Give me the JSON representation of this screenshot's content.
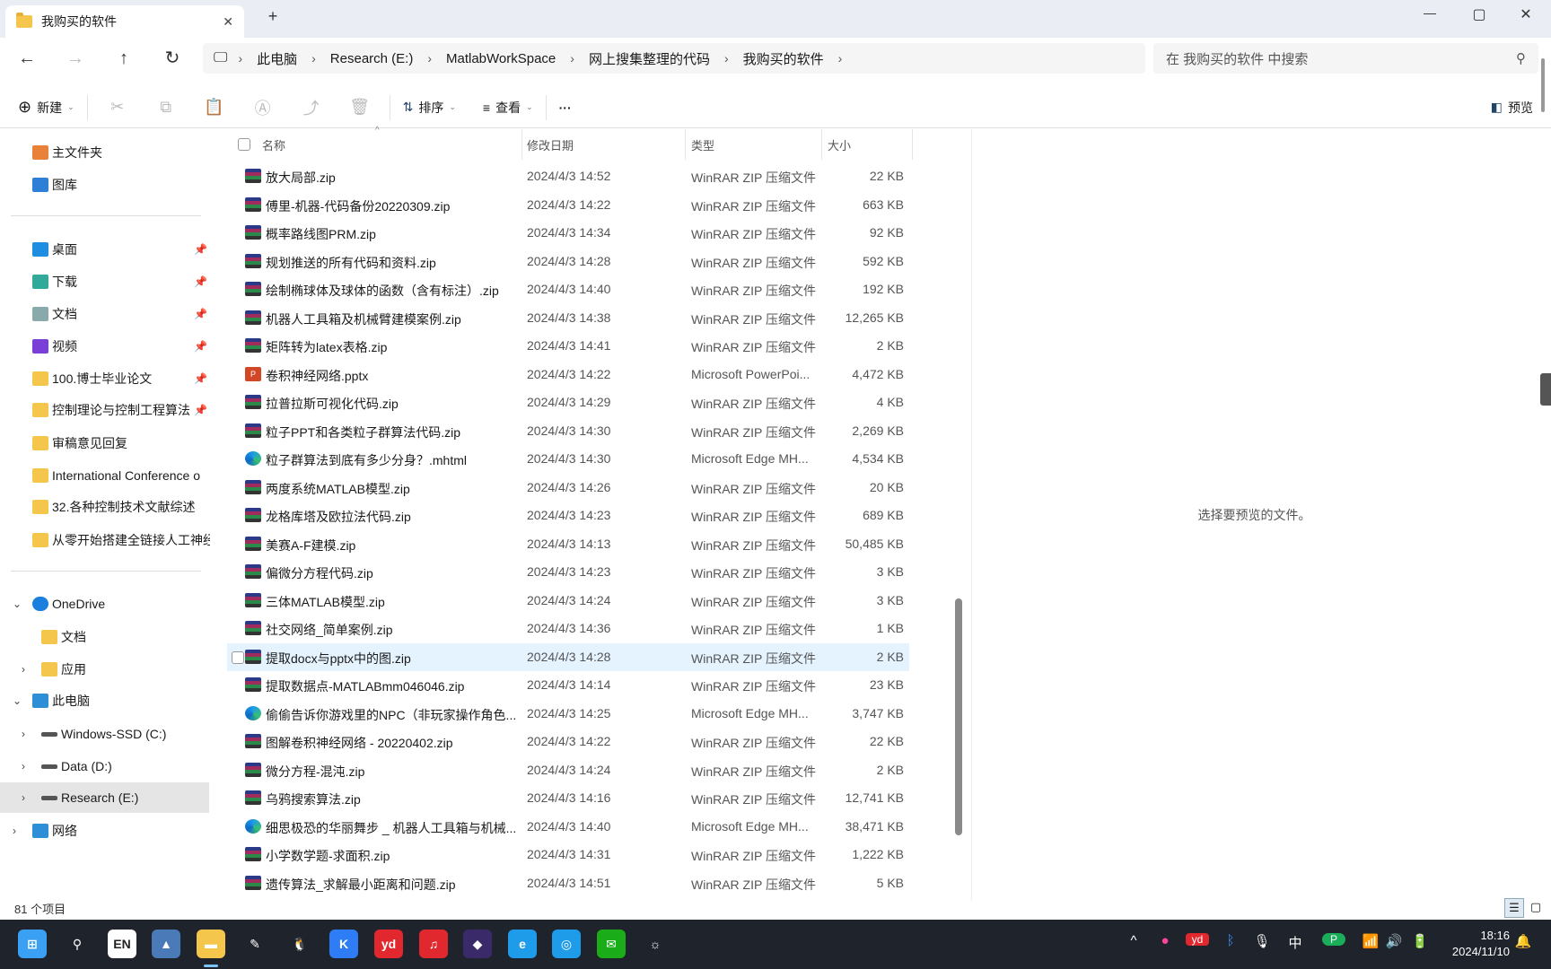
{
  "window": {
    "tab_title": "我购买的软件",
    "new_tab": "+",
    "minimize": "—",
    "maximize": "▢",
    "close": "✕"
  },
  "address": {
    "crumbs": [
      "此电脑",
      "Research (E:)",
      "MatlabWorkSpace",
      "网上搜集整理的代码",
      "我购买的软件"
    ],
    "search_placeholder": "在 我购买的软件 中搜索"
  },
  "toolbar": {
    "new": "新建",
    "sort": "排序",
    "view": "查看",
    "more": "···",
    "preview": "预览"
  },
  "sidebar": {
    "items": [
      {
        "label": "主文件夹",
        "icon": "home"
      },
      {
        "label": "图库",
        "icon": "gallery"
      },
      {
        "label": "桌面",
        "icon": "desktop",
        "pin": true
      },
      {
        "label": "下载",
        "icon": "download",
        "pin": true
      },
      {
        "label": "文档",
        "icon": "document",
        "pin": true
      },
      {
        "label": "视频",
        "icon": "video",
        "pin": true
      },
      {
        "label": "100.博士毕业论文",
        "icon": "folder",
        "pin": true
      },
      {
        "label": "控制理论与控制工程算法",
        "icon": "folder",
        "pin": true
      },
      {
        "label": "审稿意见回复",
        "icon": "folder"
      },
      {
        "label": "International Conference o",
        "icon": "folder"
      },
      {
        "label": "32.各种控制技术文献综述",
        "icon": "folder"
      },
      {
        "label": "从零开始搭建全链接人工神经",
        "icon": "folder"
      },
      {
        "label": "OneDrive",
        "icon": "cloud",
        "chevron": "⌄"
      },
      {
        "label": "文档",
        "icon": "folder"
      },
      {
        "label": "应用",
        "icon": "folder",
        "chevron": "›"
      },
      {
        "label": "此电脑",
        "icon": "pc",
        "chevron": "⌄"
      },
      {
        "label": "Windows-SSD (C:)",
        "icon": "drive",
        "chevron": "›"
      },
      {
        "label": "Data (D:)",
        "icon": "drive",
        "chevron": "›"
      },
      {
        "label": "Research (E:)",
        "icon": "drive",
        "chevron": "›",
        "selected": true
      },
      {
        "label": "网络",
        "icon": "network",
        "chevron": "›"
      }
    ]
  },
  "columns": {
    "name": "名称",
    "date": "修改日期",
    "type": "类型",
    "size": "大小"
  },
  "files": [
    {
      "name": "放大局部.zip",
      "date": "2024/4/3 14:52",
      "type": "WinRAR ZIP 压缩文件",
      "size": "22 KB",
      "icon": "zip"
    },
    {
      "name": "傅里-机器-代码备份20220309.zip",
      "date": "2024/4/3 14:22",
      "type": "WinRAR ZIP 压缩文件",
      "size": "663 KB",
      "icon": "zip"
    },
    {
      "name": "概率路线图PRM.zip",
      "date": "2024/4/3 14:34",
      "type": "WinRAR ZIP 压缩文件",
      "size": "92 KB",
      "icon": "zip"
    },
    {
      "name": "规划推送的所有代码和资料.zip",
      "date": "2024/4/3 14:28",
      "type": "WinRAR ZIP 压缩文件",
      "size": "592 KB",
      "icon": "zip"
    },
    {
      "name": "绘制椭球体及球体的函数（含有标注）.zip",
      "date": "2024/4/3 14:40",
      "type": "WinRAR ZIP 压缩文件",
      "size": "192 KB",
      "icon": "zip"
    },
    {
      "name": "机器人工具箱及机械臂建模案例.zip",
      "date": "2024/4/3 14:38",
      "type": "WinRAR ZIP 压缩文件",
      "size": "12,265 KB",
      "icon": "zip"
    },
    {
      "name": "矩阵转为latex表格.zip",
      "date": "2024/4/3 14:41",
      "type": "WinRAR ZIP 压缩文件",
      "size": "2 KB",
      "icon": "zip"
    },
    {
      "name": "卷积神经网络.pptx",
      "date": "2024/4/3 14:22",
      "type": "Microsoft PowerPoi...",
      "size": "4,472 KB",
      "icon": "pptx"
    },
    {
      "name": "拉普拉斯可视化代码.zip",
      "date": "2024/4/3 14:29",
      "type": "WinRAR ZIP 压缩文件",
      "size": "4 KB",
      "icon": "zip"
    },
    {
      "name": "粒子PPT和各类粒子群算法代码.zip",
      "date": "2024/4/3 14:30",
      "type": "WinRAR ZIP 压缩文件",
      "size": "2,269 KB",
      "icon": "zip"
    },
    {
      "name": "粒子群算法到底有多少分身？.mhtml",
      "date": "2024/4/3 14:30",
      "type": "Microsoft Edge MH...",
      "size": "4,534 KB",
      "icon": "edge"
    },
    {
      "name": "两度系统MATLAB模型.zip",
      "date": "2024/4/3 14:26",
      "type": "WinRAR ZIP 压缩文件",
      "size": "20 KB",
      "icon": "zip"
    },
    {
      "name": "龙格库塔及欧拉法代码.zip",
      "date": "2024/4/3 14:23",
      "type": "WinRAR ZIP 压缩文件",
      "size": "689 KB",
      "icon": "zip"
    },
    {
      "name": "美赛A-F建模.zip",
      "date": "2024/4/3 14:13",
      "type": "WinRAR ZIP 压缩文件",
      "size": "50,485 KB",
      "icon": "zip"
    },
    {
      "name": "偏微分方程代码.zip",
      "date": "2024/4/3 14:23",
      "type": "WinRAR ZIP 压缩文件",
      "size": "3 KB",
      "icon": "zip"
    },
    {
      "name": "三体MATLAB模型.zip",
      "date": "2024/4/3 14:24",
      "type": "WinRAR ZIP 压缩文件",
      "size": "3 KB",
      "icon": "zip"
    },
    {
      "name": "社交网络_简单案例.zip",
      "date": "2024/4/3 14:36",
      "type": "WinRAR ZIP 压缩文件",
      "size": "1 KB",
      "icon": "zip"
    },
    {
      "name": "提取docx与pptx中的图.zip",
      "date": "2024/4/3 14:28",
      "type": "WinRAR ZIP 压缩文件",
      "size": "2 KB",
      "icon": "zip",
      "hover": true
    },
    {
      "name": "提取数据点-MATLABmm046046.zip",
      "date": "2024/4/3 14:14",
      "type": "WinRAR ZIP 压缩文件",
      "size": "23 KB",
      "icon": "zip"
    },
    {
      "name": "偷偷告诉你游戏里的NPC（非玩家操作角色...",
      "date": "2024/4/3 14:25",
      "type": "Microsoft Edge MH...",
      "size": "3,747 KB",
      "icon": "edge"
    },
    {
      "name": "图解卷积神经网络 - 20220402.zip",
      "date": "2024/4/3 14:22",
      "type": "WinRAR ZIP 压缩文件",
      "size": "22 KB",
      "icon": "zip"
    },
    {
      "name": "微分方程-混沌.zip",
      "date": "2024/4/3 14:24",
      "type": "WinRAR ZIP 压缩文件",
      "size": "2 KB",
      "icon": "zip"
    },
    {
      "name": "乌鸦搜索算法.zip",
      "date": "2024/4/3 14:16",
      "type": "WinRAR ZIP 压缩文件",
      "size": "12,741 KB",
      "icon": "zip"
    },
    {
      "name": "细思极恐的华丽舞步 _ 机器人工具箱与机械...",
      "date": "2024/4/3 14:40",
      "type": "Microsoft Edge MH...",
      "size": "38,471 KB",
      "icon": "edge"
    },
    {
      "name": "小学数学题-求面积.zip",
      "date": "2024/4/3 14:31",
      "type": "WinRAR ZIP 压缩文件",
      "size": "1,222 KB",
      "icon": "zip"
    },
    {
      "name": "遗传算法_求解最小距离和问题.zip",
      "date": "2024/4/3 14:51",
      "type": "WinRAR ZIP 压缩文件",
      "size": "5 KB",
      "icon": "zip"
    }
  ],
  "preview": {
    "message": "选择要预览的文件。"
  },
  "status": {
    "count": "81 个项目"
  },
  "taskbar": {
    "apps": [
      {
        "name": "start",
        "glyph": "⊞",
        "color": "#3aa0f3"
      },
      {
        "name": "search",
        "glyph": "⚲",
        "color": "transparent"
      },
      {
        "name": "en-input",
        "glyph": "EN",
        "color": "#fff"
      },
      {
        "name": "photos",
        "glyph": "▲",
        "color": "#4a7ab8"
      },
      {
        "name": "file-explorer",
        "glyph": "▬",
        "color": "#f5c64c"
      },
      {
        "name": "pen",
        "glyph": "✎",
        "color": "transparent"
      },
      {
        "name": "qq",
        "glyph": "🐧",
        "color": "transparent"
      },
      {
        "name": "k-app",
        "glyph": "K",
        "color": "#2f7df6"
      },
      {
        "name": "youdao",
        "glyph": "yd",
        "color": "#e0282e"
      },
      {
        "name": "music",
        "glyph": "♫",
        "color": "#e0282e"
      },
      {
        "name": "game",
        "glyph": "◆",
        "color": "#3a2a6a"
      },
      {
        "name": "edge",
        "glyph": "e",
        "color": "#1e9be9"
      },
      {
        "name": "browser",
        "glyph": "◎",
        "color": "#1e9be9"
      },
      {
        "name": "wechat-work",
        "glyph": "✉",
        "color": "#1aad19"
      },
      {
        "name": "assistant",
        "glyph": "☼",
        "color": "transparent"
      }
    ],
    "tray": [
      "^",
      "●",
      "yd",
      "ᛒ",
      "🎙",
      "中",
      "P",
      "📶",
      "🔊",
      "🔋"
    ],
    "time": "18:16",
    "date": "2024/11/10"
  }
}
